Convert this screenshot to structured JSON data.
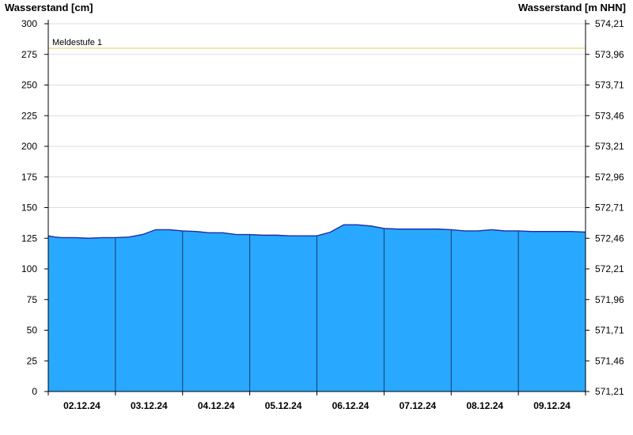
{
  "chart_data": {
    "type": "area",
    "title": "",
    "ylabel_left": "Wasserstand [cm]",
    "ylabel_right": "Wasserstand [m NHN]",
    "ylim": [
      0,
      300
    ],
    "yticks_left": [
      0,
      25,
      50,
      75,
      100,
      125,
      150,
      175,
      200,
      225,
      250,
      275,
      300
    ],
    "yticks_right": [
      "571,21",
      "571,46",
      "571,71",
      "571,96",
      "572,21",
      "572,46",
      "572,71",
      "572,96",
      "573,21",
      "573,46",
      "573,71",
      "573,96",
      "574,21"
    ],
    "x_range": [
      "01.12.24 00:00",
      "09.12.24 00:00"
    ],
    "x_day_start": "01.12.24",
    "xticks": [
      "02.12.24",
      "03.12.24",
      "04.12.24",
      "05.12.24",
      "06.12.24",
      "07.12.24",
      "08.12.24",
      "09.12.24"
    ],
    "grid": true,
    "threshold": {
      "label": "Meldestufe 1",
      "value": 280,
      "color": "#e8d870"
    },
    "colors": {
      "fill": "#29a8ff",
      "line": "#1a2ea8",
      "day_separator": "#1a3a6a"
    },
    "series": [
      {
        "x_day": [
          0.0,
          0.1,
          0.2,
          0.4,
          0.6,
          0.8,
          1.0,
          1.2,
          1.4,
          1.6,
          1.8,
          2.0,
          2.2,
          2.4,
          2.6,
          2.8,
          3.0,
          3.2,
          3.4,
          3.6,
          3.8,
          4.0,
          4.2,
          4.4,
          4.6,
          4.8,
          5.0,
          5.2,
          5.4,
          5.6,
          5.8,
          6.0,
          6.2,
          6.4,
          6.6,
          6.8,
          7.0,
          7.2,
          7.4,
          7.6,
          7.8,
          8.0
        ],
        "y": [
          127,
          126,
          125.5,
          125.5,
          125,
          125.5,
          125.5,
          126,
          128,
          132,
          132,
          131,
          130.5,
          129.5,
          129.5,
          128,
          128,
          127.5,
          127.5,
          127,
          127,
          127,
          130,
          136,
          136,
          135,
          133,
          132.5,
          132.5,
          132.5,
          132.5,
          132,
          131,
          131,
          132,
          131,
          131,
          130.5,
          130.5,
          130.5,
          130.5,
          130
        ]
      }
    ]
  }
}
